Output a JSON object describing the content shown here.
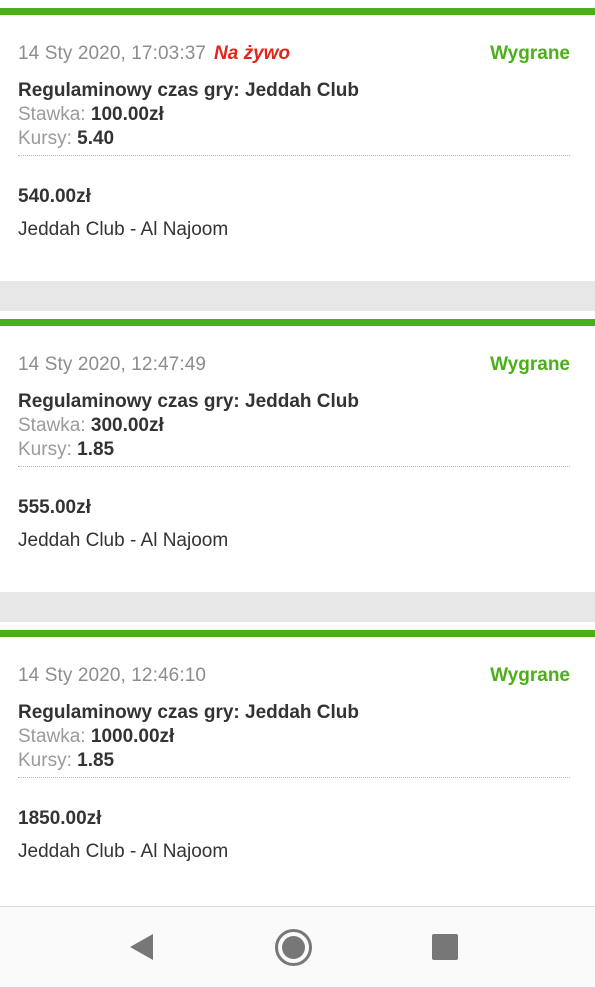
{
  "bets": [
    {
      "date": "14 Sty 2020, 17:03:37",
      "live_label": "Na żywo",
      "status": "Wygrane",
      "market": "Regulaminowy czas gry: Jeddah Club",
      "stake_label": "Stawka:",
      "stake": "100.00zł",
      "odds_label": "Kursy:",
      "odds": "5.40",
      "payout": "540.00zł",
      "event": "Jeddah Club - Al Najoom"
    },
    {
      "date": "14 Sty 2020, 12:47:49",
      "live_label": "",
      "status": "Wygrane",
      "market": "Regulaminowy czas gry: Jeddah Club",
      "stake_label": "Stawka:",
      "stake": "300.00zł",
      "odds_label": "Kursy:",
      "odds": "1.85",
      "payout": "555.00zł",
      "event": "Jeddah Club - Al Najoom"
    },
    {
      "date": "14 Sty 2020, 12:46:10",
      "live_label": "",
      "status": "Wygrane",
      "market": "Regulaminowy czas gry: Jeddah Club",
      "stake_label": "Stawka:",
      "stake": "1000.00zł",
      "odds_label": "Kursy:",
      "odds": "1.85",
      "payout": "1850.00zł",
      "event": "Jeddah Club - Al Najoom"
    }
  ],
  "colors": {
    "accent_green": "#4caf1a",
    "live_red": "#e4241b",
    "separator_gray": "#e7e7e7"
  },
  "navbar": {
    "icons": [
      "back-triangle-icon",
      "home-circle-icon",
      "recents-square-icon"
    ]
  }
}
